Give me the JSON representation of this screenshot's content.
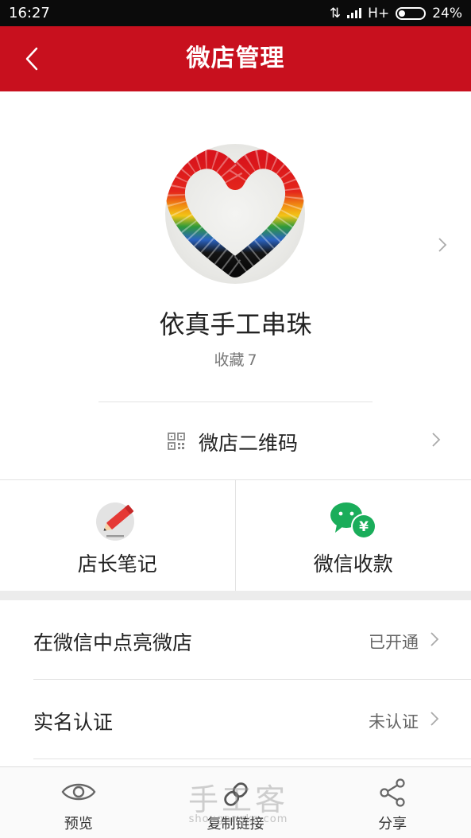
{
  "status_bar": {
    "time": "16:27",
    "network": "H+",
    "battery": "24%"
  },
  "header": {
    "title": "微店管理",
    "back_icon": "chevron-left-icon"
  },
  "profile": {
    "shop_name": "依真手工串珠",
    "favorites_label": "收藏",
    "favorites_count": "7"
  },
  "qr_row": {
    "label": "微店二维码",
    "icon": "qr-code-icon"
  },
  "grid": [
    {
      "label": "店长笔记",
      "icon": "pencil-icon"
    },
    {
      "label": "微信收款",
      "icon": "wechat-pay-icon"
    }
  ],
  "settings": [
    {
      "label": "在微信中点亮微店",
      "value": "已开通"
    },
    {
      "label": "实名认证",
      "value": "未认证"
    }
  ],
  "bottom_tabs": [
    {
      "label": "预览",
      "icon": "eye-icon"
    },
    {
      "label": "复制链接",
      "icon": "link-icon"
    },
    {
      "label": "分享",
      "icon": "share-icon"
    }
  ],
  "watermark": {
    "text": "手工客",
    "sub": "shougongke.com"
  },
  "colors": {
    "brand_red": "#c8101e",
    "wechat_green": "#1aad5a"
  }
}
